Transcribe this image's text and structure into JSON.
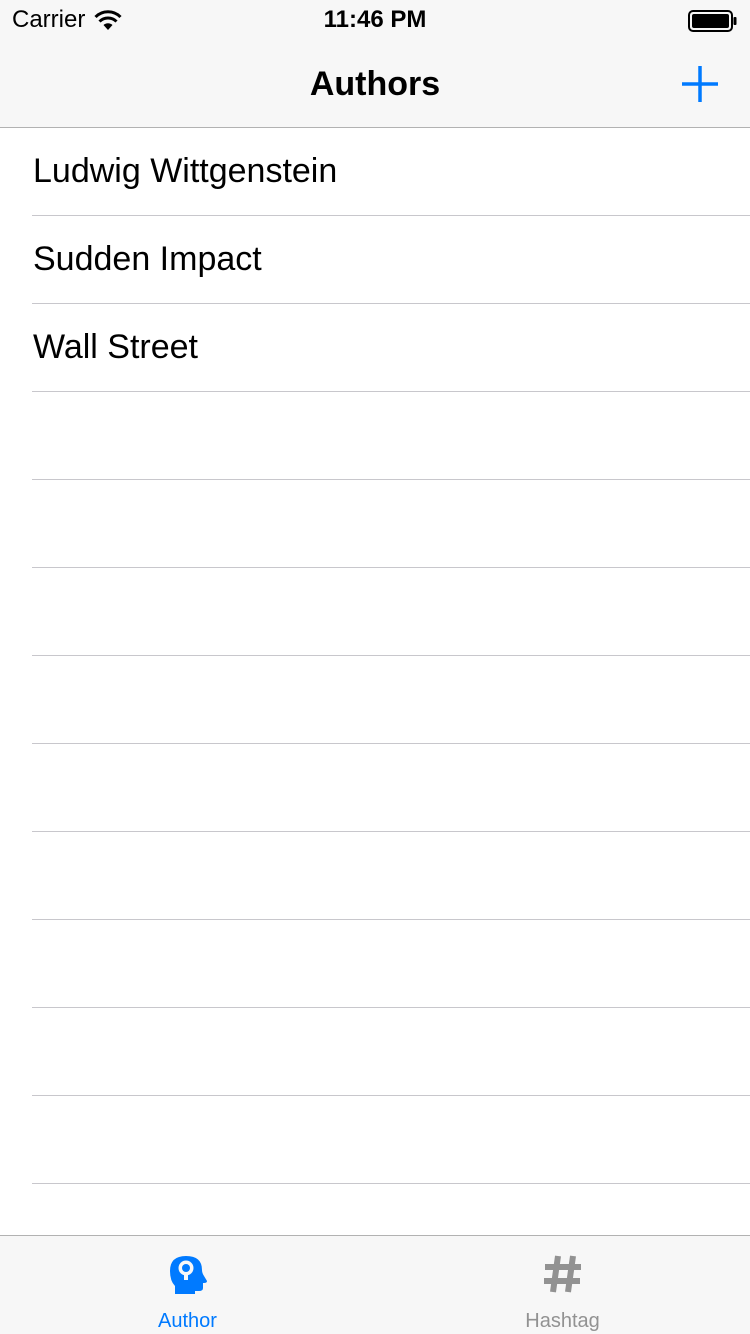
{
  "status_bar": {
    "carrier": "Carrier",
    "time": "11:46 PM",
    "icons": [
      "wifi-icon",
      "battery-icon"
    ]
  },
  "nav_bar": {
    "title": "Authors",
    "add_button_icon": "plus-icon"
  },
  "list": {
    "items": [
      {
        "label": "Ludwig Wittgenstein"
      },
      {
        "label": "Sudden Impact"
      },
      {
        "label": "Wall Street"
      }
    ],
    "empty_rows": 9
  },
  "tab_bar": {
    "tabs": [
      {
        "label": "Author",
        "icon": "head-icon",
        "selected": true
      },
      {
        "label": "Hashtag",
        "icon": "hashtag-icon",
        "selected": false
      }
    ]
  },
  "colors": {
    "accent": "#007aff",
    "inactive": "#929292",
    "bar_background": "#f7f7f7",
    "separator": "#c8c7cc"
  }
}
